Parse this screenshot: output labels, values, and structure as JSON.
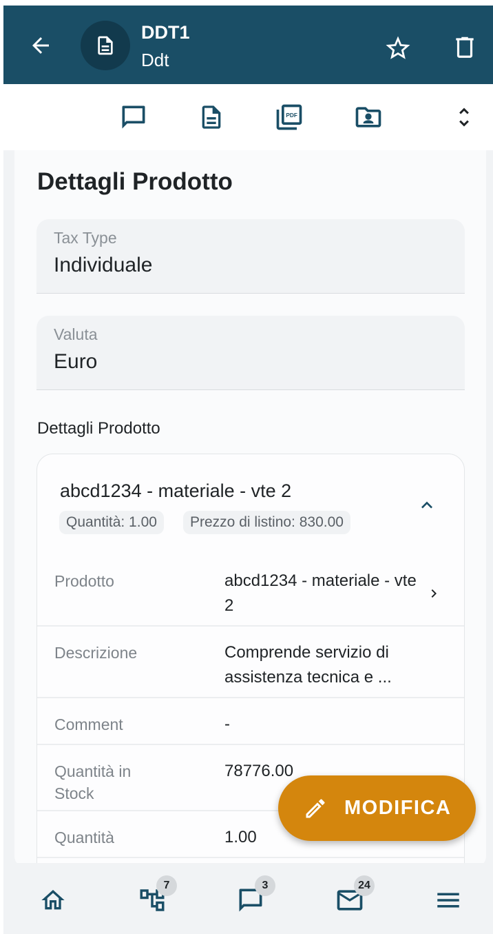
{
  "colors": {
    "header_bg": "#1a4e66",
    "accent": "#1a4e66",
    "fab_bg": "#d4860d",
    "badge_bg": "#d5d8db"
  },
  "header": {
    "title": "DDT1",
    "subtitle": "Ddt",
    "icons": [
      "arrow-back-icon",
      "document-icon",
      "star-outline-icon",
      "trash-icon"
    ]
  },
  "toolbar": {
    "icons": [
      "comment-icon",
      "document-icon",
      "pdf-icon",
      "folder-contact-icon",
      "expand-collapse-icon"
    ]
  },
  "section": {
    "title": "Dettagli Prodotto"
  },
  "fields": {
    "tax_type": {
      "label": "Tax Type",
      "value": "Individuale"
    },
    "currency": {
      "label": "Valuta",
      "value": "Euro"
    }
  },
  "products_label": "Dettagli Prodotto",
  "product": {
    "name": "abcd1234 - materiale - vte 2",
    "chips": {
      "quantity": "Quantità: 1.00",
      "list_price": "Prezzo di listino: 830.00"
    },
    "rows": [
      {
        "label": "Prodotto",
        "value": "abcd1234 - materiale - vte 2"
      },
      {
        "label": "Descrizione",
        "value": "Comprende servizio di assistenza tecnica e ..."
      },
      {
        "label": "Comment",
        "value": "-"
      },
      {
        "label": "Quantità in Stock",
        "value": "78776.00"
      },
      {
        "label": "Quantità",
        "value": "1.00"
      }
    ]
  },
  "fab": {
    "label": "MODIFICA",
    "icon": "pencil-icon"
  },
  "bottom_nav": {
    "items": [
      {
        "icon": "home-icon",
        "badge": ""
      },
      {
        "icon": "hierarchy-icon",
        "badge": "7"
      },
      {
        "icon": "comment-icon",
        "badge": "3"
      },
      {
        "icon": "mail-icon",
        "badge": "24"
      },
      {
        "icon": "menu-icon",
        "badge": ""
      }
    ]
  }
}
